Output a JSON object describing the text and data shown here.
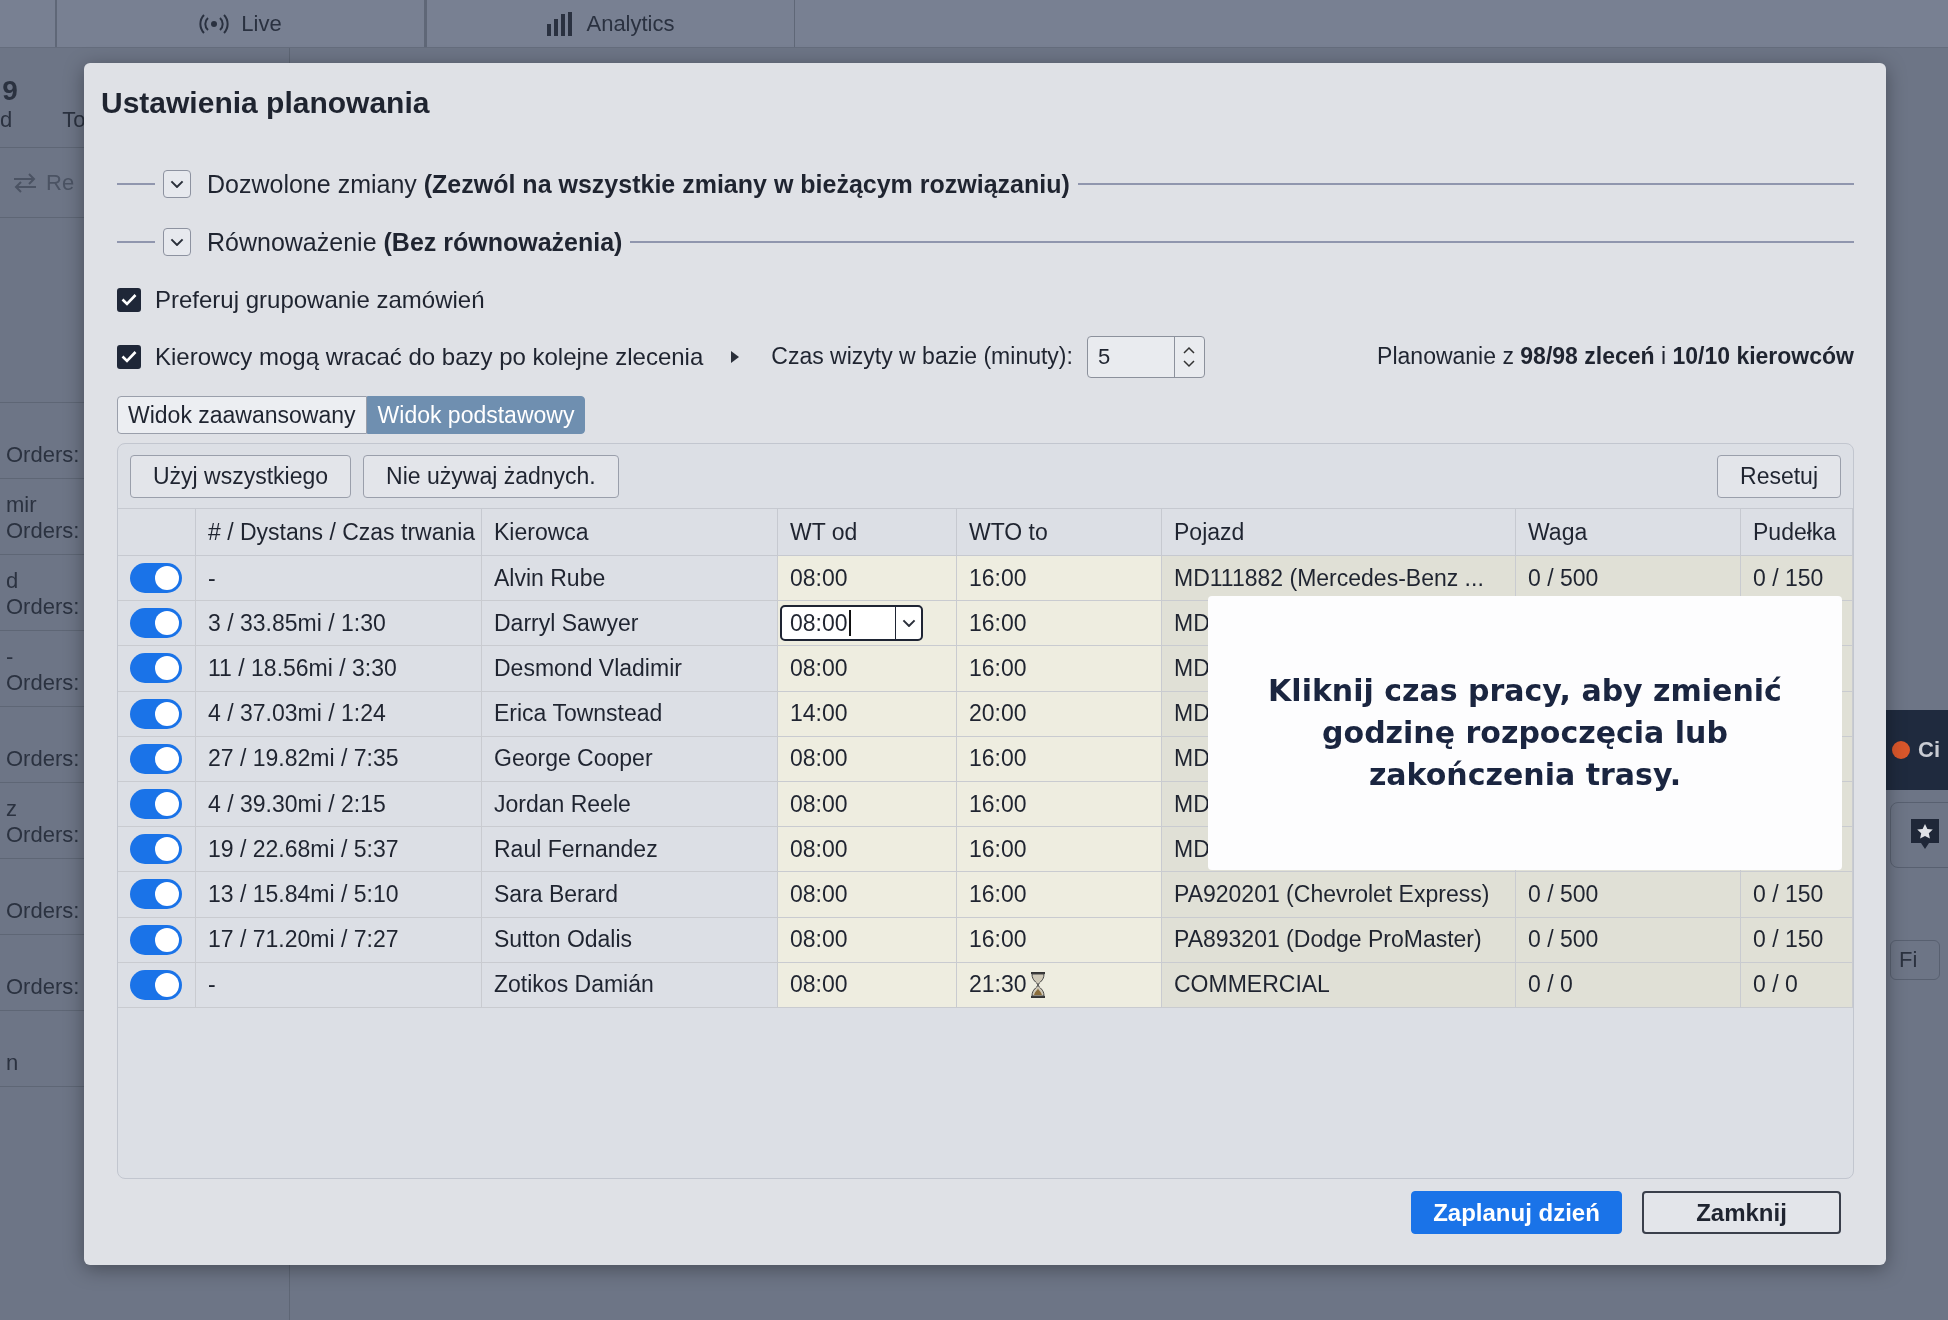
{
  "background": {
    "tabs": [
      {
        "label": "Live"
      },
      {
        "label": "Analytics"
      }
    ],
    "header": {
      "number": "9",
      "left": "d",
      "label": "To",
      "action": "Re"
    },
    "left_rows": [
      {
        "label": "Orders:"
      },
      {
        "top": "mir",
        "label": "Orders:"
      },
      {
        "top": "d",
        "label": "Orders:"
      },
      {
        "top": "-",
        "label": "Orders:"
      },
      {
        "label": "Orders:"
      },
      {
        "top": "z",
        "label": "Orders:"
      },
      {
        "label": "Orders:"
      },
      {
        "label": "Orders:"
      },
      {
        "top": "n"
      }
    ],
    "right": {
      "status": "Ci",
      "button": "Fi"
    }
  },
  "dialog": {
    "title": "Ustawienia planowania",
    "sections": [
      {
        "label": "Dozwolone zmiany **(Zezwól na wszystkie zmiany w bieżącym rozwiązaniu)**",
        "expanded": false
      },
      {
        "label": "Równoważenie **(Bez równoważenia)**",
        "expanded": false
      }
    ],
    "options": [
      {
        "label": "Preferuj grupowanie zamówień",
        "checked": true
      },
      {
        "label": "Kierowcy mogą wracać do bazy po kolejne zlecenia",
        "checked": true
      }
    ],
    "visit_time": {
      "label": "Czas wizyty w bazie (minuty):",
      "value": "5"
    },
    "summary": "Planowanie z **98/98 zleceń** i **10/10 kierowców**",
    "views": [
      {
        "label": "Widok zaawansowany",
        "selected": false
      },
      {
        "label": "Widok podstawowy",
        "selected": true
      }
    ],
    "table_buttons": {
      "left": [
        "Użyj wszystkiego",
        "Nie używaj żadnych."
      ],
      "right": "Resetuj"
    },
    "table": {
      "columns": [
        "# / Dystans / Czas trwania",
        "Kierowca",
        "WT od",
        "WTO to",
        "Pojazd",
        "Waga",
        "Pudełka"
      ],
      "rows": [
        {
          "on": true,
          "route": "-",
          "driver": "Alvin Rube",
          "wt_from": "08:00",
          "wt_to": "16:00",
          "vehicle": "MD111882 (Mercedes-Benz ...",
          "weight": "0 / 500",
          "boxes": "0 / 150"
        },
        {
          "on": true,
          "route": "3 / 33.85mi / 1:30",
          "driver": "Darryl Sawyer",
          "wt_from": "08:00",
          "editing": true,
          "wt_to": "16:00",
          "vehicle": "MD"
        },
        {
          "on": true,
          "route": "11 / 18.56mi / 3:30",
          "driver": "Desmond Vladimir",
          "wt_from": "08:00",
          "wt_to": "16:00",
          "vehicle": "MD"
        },
        {
          "on": true,
          "route": "4 / 37.03mi / 1:24",
          "driver": "Erica Townstead",
          "wt_from": "14:00",
          "wt_to": "20:00",
          "vehicle": "MD"
        },
        {
          "on": true,
          "route": "27 / 19.82mi / 7:35",
          "driver": "George Cooper",
          "wt_from": "08:00",
          "wt_to": "16:00",
          "vehicle": "MD"
        },
        {
          "on": true,
          "route": "4 / 39.30mi / 2:15",
          "driver": "Jordan Reele",
          "wt_from": "08:00",
          "wt_to": "16:00",
          "vehicle": "MD"
        },
        {
          "on": true,
          "route": "19 / 22.68mi / 5:37",
          "driver": "Raul Fernandez",
          "wt_from": "08:00",
          "wt_to": "16:00",
          "vehicle": "MD"
        },
        {
          "on": true,
          "route": "13 / 15.84mi / 5:10",
          "driver": "Sara Berard",
          "wt_from": "08:00",
          "wt_to": "16:00",
          "vehicle": "PA920201 (Chevrolet Express)",
          "weight": "0 / 500",
          "boxes": "0 / 150"
        },
        {
          "on": true,
          "route": "17 / 71.20mi / 7:27",
          "driver": "Sutton Odalis",
          "wt_from": "08:00",
          "wt_to": "16:00",
          "vehicle": "PA893201 (Dodge ProMaster)",
          "weight": "0 / 500",
          "boxes": "0 / 150"
        },
        {
          "on": true,
          "route": "-",
          "driver": "Zotikos Damián",
          "wt_from": "08:00",
          "wt_to": "21:30",
          "pending": true,
          "vehicle": "COMMERCIAL",
          "weight": "0 / 0",
          "boxes": "0 / 0"
        }
      ]
    },
    "hint": "Kliknij czas pracy, aby zmienić godzinę rozpoczęcia lub zakończenia trasy.",
    "buttons": [
      {
        "label": "Zaplanuj dzień",
        "kind": "primary"
      },
      {
        "label": "Zamknij",
        "kind": "secondary"
      }
    ]
  }
}
